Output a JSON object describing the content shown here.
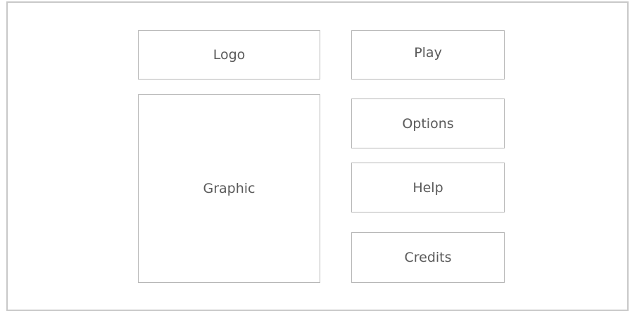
{
  "logo": {
    "label": "Logo"
  },
  "graphic": {
    "label": "Graphic"
  },
  "menu": {
    "play_label": "Play",
    "options_label": "Options",
    "help_label": "Help",
    "credits_label": "Credits"
  },
  "colors": {
    "border": "#b7b7b7",
    "frame_border": "#c8c8c8",
    "text": "#5a5a5a",
    "background": "#ffffff"
  }
}
